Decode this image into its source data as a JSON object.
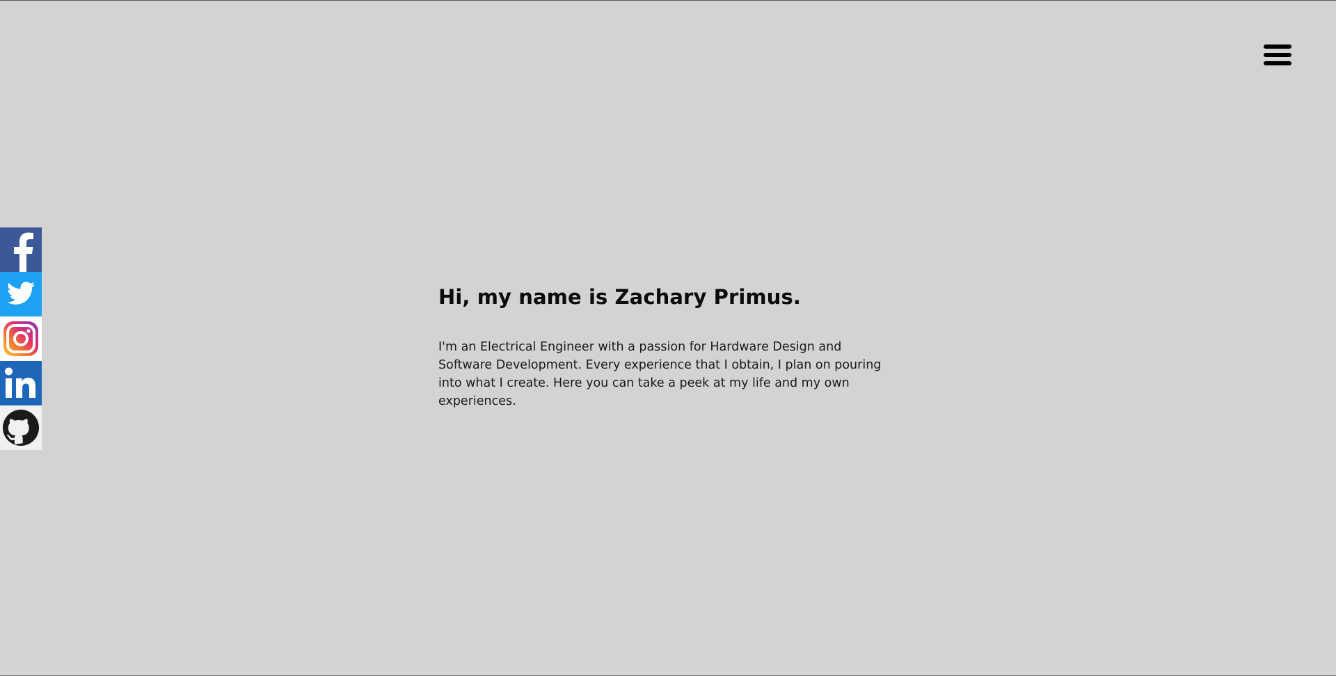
{
  "hero": {
    "heading": "Hi, my name is Zachary Primus.",
    "description": "I'm an Electrical Engineer with a passion for Hardware Design and Software Development. Every experience that I obtain, I plan on pouring into what I create. Here you can take a peek at my life and my own experiences."
  },
  "nav": {
    "menu_icon": "hamburger-menu-icon"
  },
  "social": [
    {
      "name": "Facebook",
      "icon": "facebook-icon",
      "color": "#3b5998"
    },
    {
      "name": "Twitter",
      "icon": "twitter-icon",
      "color": "#1da1f2"
    },
    {
      "name": "Instagram",
      "icon": "instagram-icon",
      "color": "#e1306c"
    },
    {
      "name": "LinkedIn",
      "icon": "linkedin-icon",
      "color": "#1d66b9"
    },
    {
      "name": "GitHub",
      "icon": "github-icon",
      "color": "#1b1b1b"
    }
  ],
  "colors": {
    "background": "#d3d3d3",
    "text": "#0b0b0b"
  }
}
